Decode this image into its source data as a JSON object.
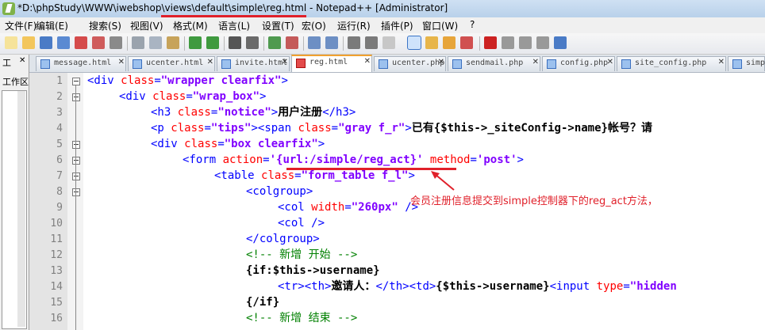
{
  "window": {
    "title": "*D:\\phpStudy\\WWW\\iwebshop\\views\\default\\simple\\reg.html - Notepad++ [Administrator]"
  },
  "menu": [
    "文件(F)",
    "编辑(E)",
    "搜索(S)",
    "视图(V)",
    "格式(M)",
    "语言(L)",
    "设置(T)",
    "宏(O)",
    "运行(R)",
    "插件(P)",
    "窗口(W)",
    "?"
  ],
  "left_panel": {
    "label_top": "工",
    "label_bottom": "工作区",
    "close": "✕"
  },
  "tabs": [
    {
      "label": "message.html",
      "close": "✕",
      "active": false
    },
    {
      "label": "ucenter.html",
      "close": "✕",
      "active": false
    },
    {
      "label": "invite.html",
      "close": "✕",
      "active": false
    },
    {
      "label": "reg.html",
      "close": "✕",
      "active": true
    },
    {
      "label": "ucenter.php",
      "close": "✕",
      "active": false
    },
    {
      "label": "sendmail.php",
      "close": "✕",
      "active": false
    },
    {
      "label": "config.php",
      "close": "✕",
      "active": false
    },
    {
      "label": "site_config.php",
      "close": "✕",
      "active": false
    },
    {
      "label": "simpl",
      "close": "",
      "active": false
    }
  ],
  "line_numbers": [
    "1",
    "2",
    "3",
    "4",
    "5",
    "6",
    "7",
    "8",
    "9",
    "10",
    "11",
    "12",
    "13",
    "14",
    "15",
    "16"
  ],
  "code": [
    [
      "<div ",
      "class",
      "=",
      "\"wrapper clearfix\"",
      ">"
    ],
    [
      "<div ",
      "class",
      "=",
      "\"wrap_box\"",
      ">"
    ],
    [
      "<h3 ",
      "class",
      "=",
      "\"notice\"",
      ">",
      "用户注册",
      "</h3>"
    ],
    [
      "<p ",
      "class",
      "=",
      "\"tips\"",
      "><span ",
      "class",
      "=",
      "\"gray f_r\"",
      ">",
      "已有{$this->_siteConfig->name}帐号？请"
    ],
    [
      "<div ",
      "class",
      "=",
      "\"box clearfix\"",
      ">"
    ],
    [
      "<form ",
      "action",
      "=",
      "'{url:/simple/reg_act}'",
      " ",
      "method",
      "=",
      "'post'",
      ">"
    ],
    [
      "<table ",
      "class",
      "=",
      "\"form_table f_l\"",
      ">"
    ],
    [
      "<colgroup>"
    ],
    [
      "<col ",
      "width",
      "=",
      "\"260px\"",
      " />"
    ],
    [
      "<col />"
    ],
    [
      "</colgroup>"
    ],
    [
      "<!-- 新增 开始 -->"
    ],
    [
      "{if:$this->username}"
    ],
    [
      "<tr><th>",
      "邀请人：",
      "</th><td>",
      "{$this->username}",
      "<input ",
      "type",
      "=",
      "\"hidden"
    ],
    [
      "{/if}"
    ],
    [
      "<!-- 新增 结束 -->"
    ]
  ],
  "annotation": "会员注册信息提交到simple控制器下的reg_act方法，",
  "colors": {
    "tag": "#0000ff",
    "attr": "#ff0000",
    "value": "#8000ff",
    "comment": "#008000",
    "annotation": "#e0202a"
  }
}
